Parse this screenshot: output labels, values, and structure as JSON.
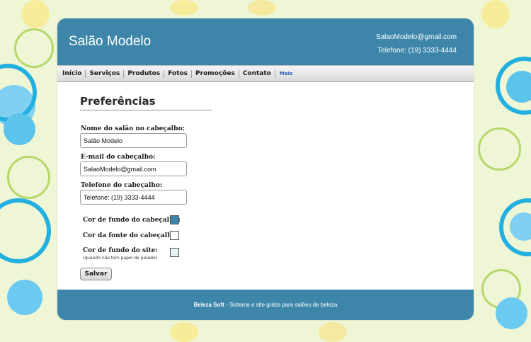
{
  "colors": {
    "header_bg": "#3d86aa",
    "header_font": "#ffffff",
    "site_bg": "#e6f2f4",
    "accent_link": "#2a5fb0"
  },
  "header": {
    "title": "Salão Modelo",
    "email": "SalaoModelo@gmail.com",
    "phone": "Telefone: (19) 3333-4444"
  },
  "nav": {
    "items": [
      "Início",
      "Serviços",
      "Produtos",
      "Fotos",
      "Promoções",
      "Contato"
    ],
    "more": "Mais"
  },
  "form": {
    "title": "Preferências",
    "name_label": "Nome do salão no cabeçalho:",
    "name_value": "Salão Modelo",
    "email_label": "E-mail do cabeçalho:",
    "email_value": "SalaoModelo@gmail.com",
    "phone_label": "Telefone do cabeçalho:",
    "phone_value": "Telefone: (19) 3333-4444",
    "header_bg_label": "Cor de fundo do cabeçalho:",
    "header_font_label": "Cor da fonte do cabeçalho:",
    "site_bg_label": "Cor de fundo do site:",
    "site_bg_note": "(quando não tem papel de parede)",
    "save_label": "Salvar"
  },
  "footer": {
    "brand": "Beleza Soft",
    "text": " - Sistema e site grátis para salões de beleza"
  }
}
